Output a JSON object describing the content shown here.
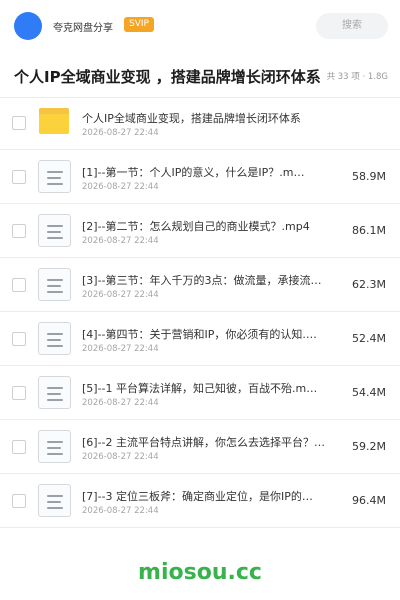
{
  "header": {
    "app_name": "夸克网盘分享",
    "badge": "SVIP",
    "search_placeholder": "搜索"
  },
  "share": {
    "title": "个人IP全域商业变现 ，搭建品牌增长闭环体系",
    "meta": "共 33 项 · 1.8G"
  },
  "items": [
    {
      "type": "folder",
      "name": "个人IP全域商业变现，搭建品牌增长闭环体系",
      "date": "2026-08-27 22:44",
      "size": ""
    },
    {
      "type": "file",
      "name": "[1]--第一节：个人IP的意义，什么是IP？.m…",
      "date": "2026-08-27 22:44",
      "size": "58.9M"
    },
    {
      "type": "file",
      "name": "[2]--第二节：怎么规划自己的商业模式？.mp4",
      "date": "2026-08-27 22:44",
      "size": "86.1M"
    },
    {
      "type": "file",
      "name": "[3]--第三节：年入千万的3点：做流量，承接流量…",
      "date": "2026-08-27 22:44",
      "size": "62.3M"
    },
    {
      "type": "file",
      "name": "[4]--第四节：关于营销和IP，你必须有的认知.…",
      "date": "2026-08-27 22:44",
      "size": "52.4M"
    },
    {
      "type": "file",
      "name": "[5]--1 平台算法详解，知己知彼，百战不殆.m…",
      "date": "2026-08-27 22:44",
      "size": "54.4M"
    },
    {
      "type": "file",
      "name": "[6]--2 主流平台特点讲解，你怎么去选择平台？…",
      "date": "2026-08-27 22:44",
      "size": "59.2M"
    },
    {
      "type": "file",
      "name": "[7]--3 定位三板斧：确定商业定位，是你IP的…",
      "date": "2026-08-27 22:44",
      "size": "96.4M"
    }
  ],
  "watermark": "miosou.cc",
  "colors": {
    "accent": "#2f7cf6",
    "svip": "#f5a524",
    "folder": "#fbd13c",
    "watermark": "#37b24d"
  }
}
